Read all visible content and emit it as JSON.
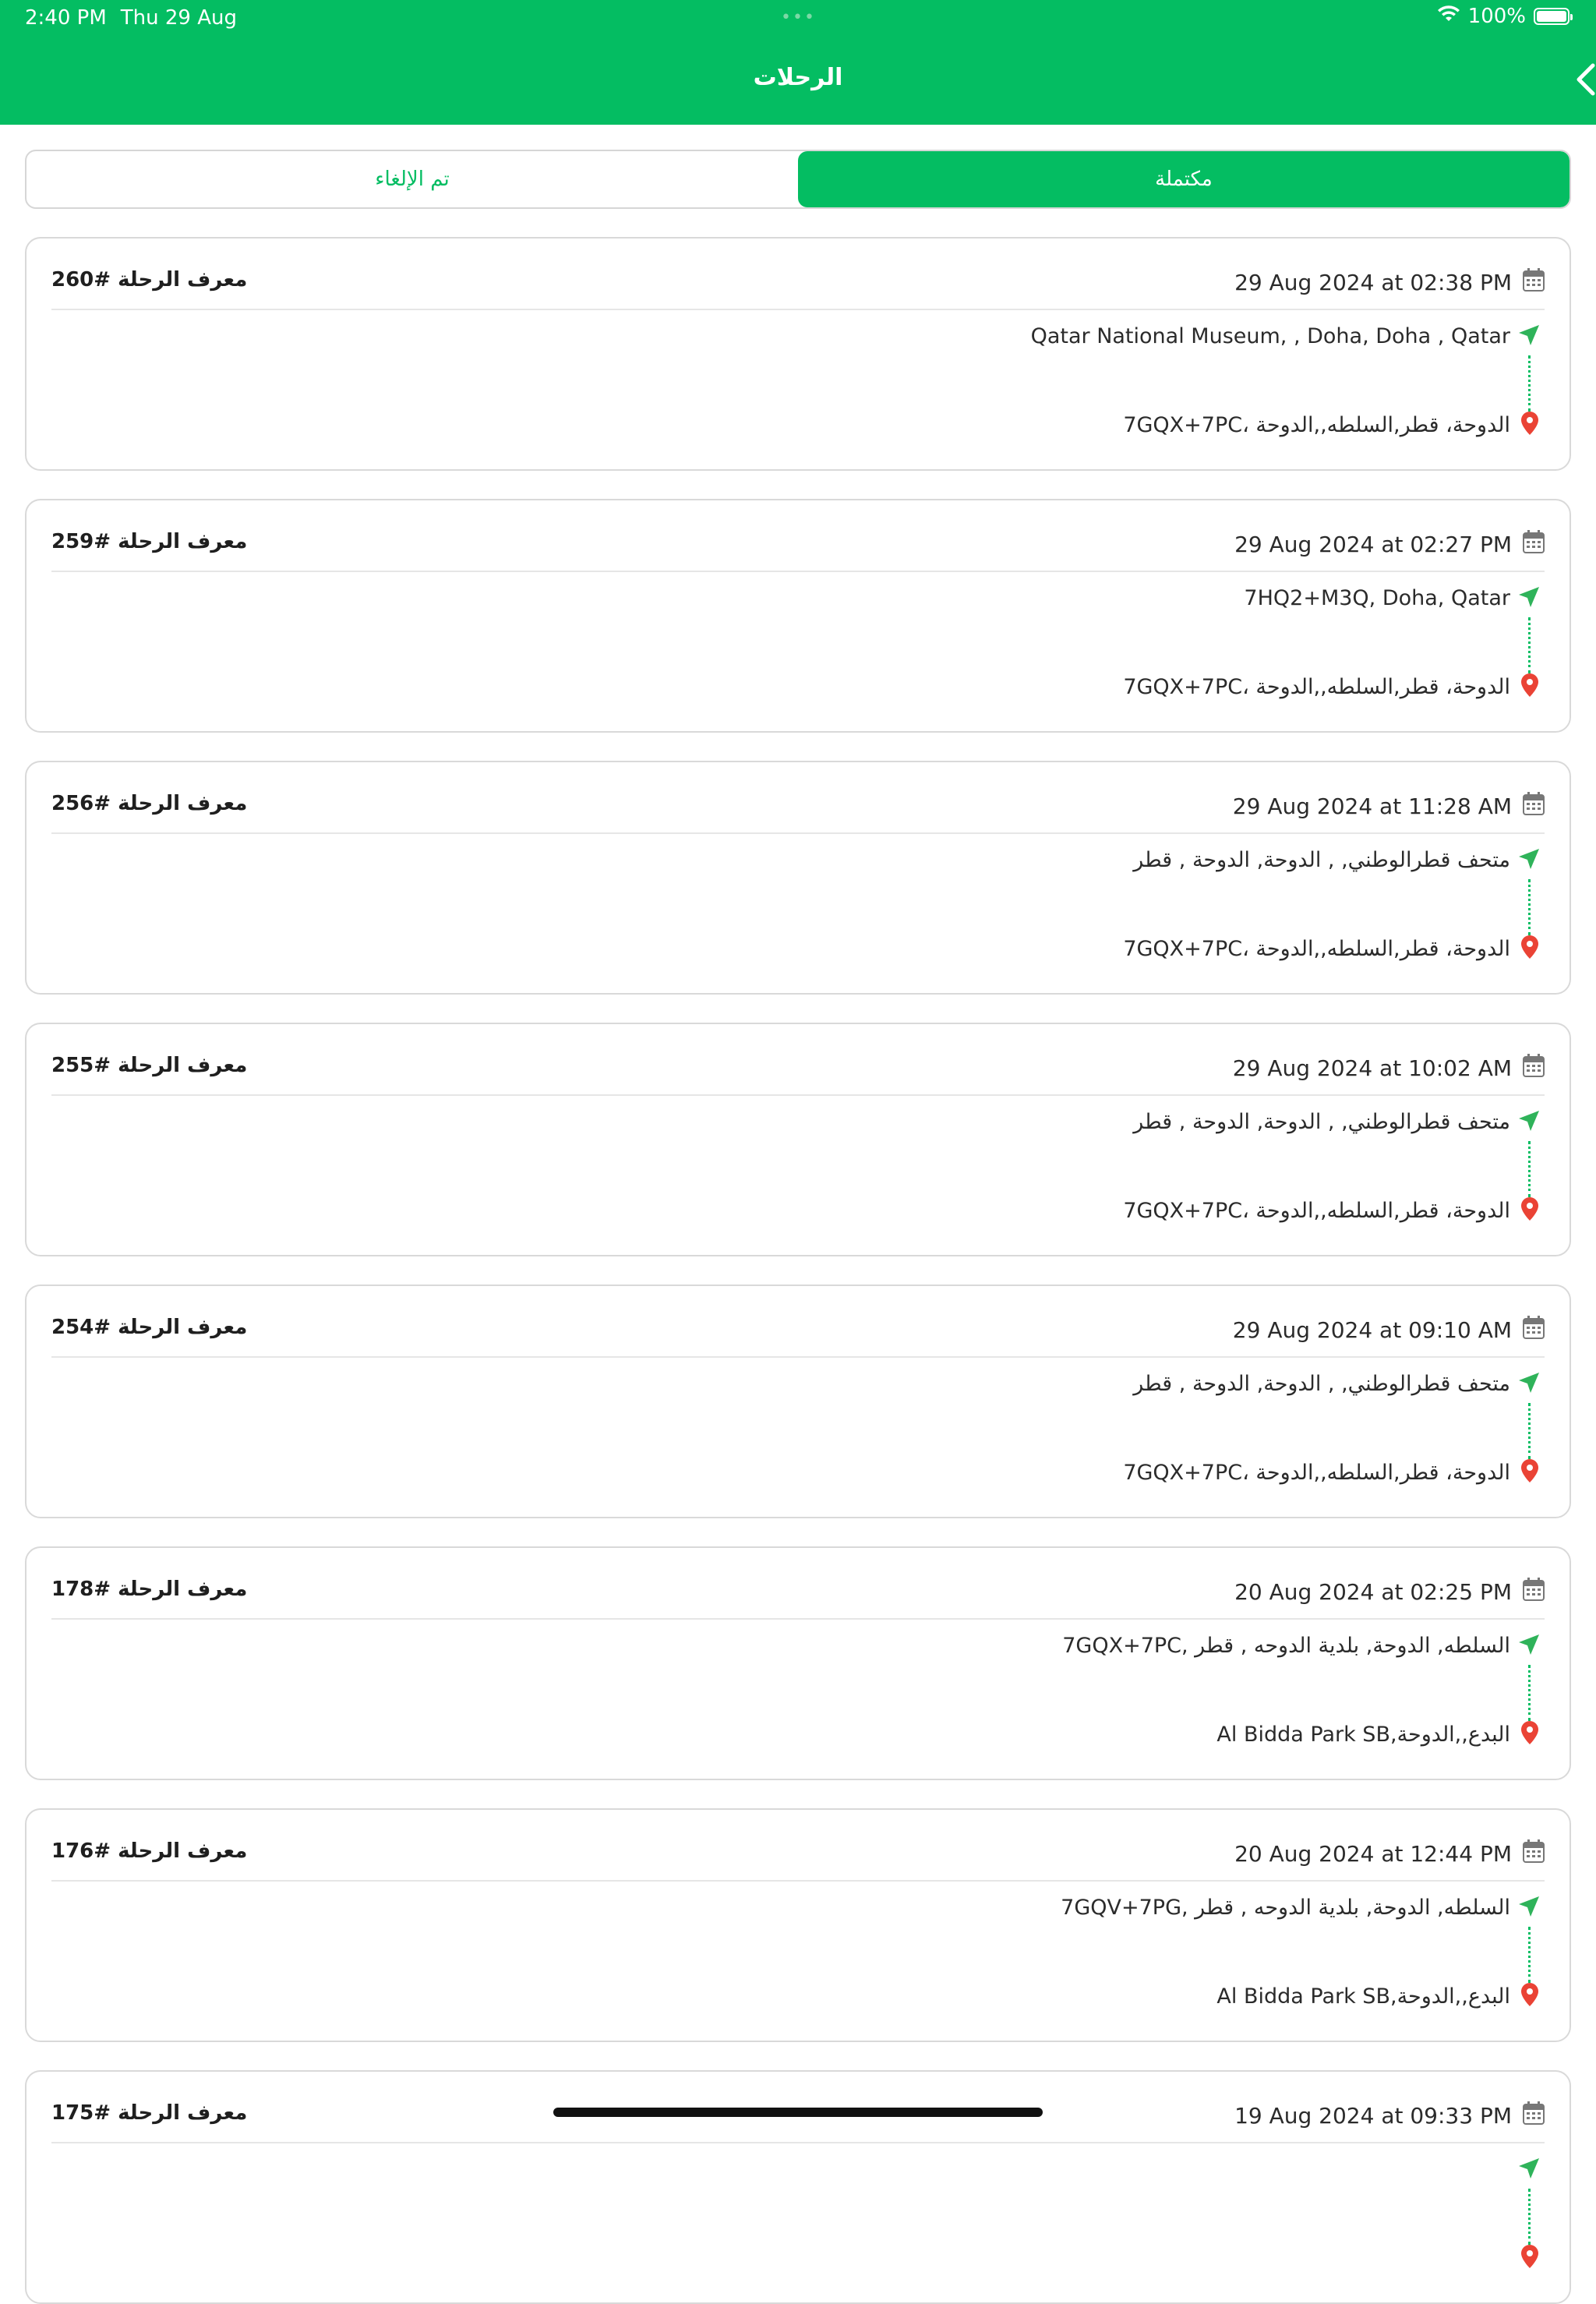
{
  "status_bar": {
    "time": "2:40 PM",
    "date": "Thu 29 Aug",
    "battery": "100%"
  },
  "header": {
    "title": "الرحلات"
  },
  "tabs": {
    "cancelled": "تم الإلغاء",
    "completed": "مكتملة",
    "active": "completed"
  },
  "colors": {
    "primary": "#04bd62",
    "pin": "#ea4335",
    "border": "#d9d9d9"
  },
  "trips": [
    {
      "id": "معرف الرحلة #260",
      "date": "29 Aug 2024 at 02:38 PM",
      "pickup": "Qatar National Museum, , Doha, Doha , Qatar",
      "dropoff": "7GQX+7PC، الدوحة، قطر,السلطه,,الدوحة"
    },
    {
      "id": "معرف الرحلة #259",
      "date": "29 Aug 2024 at 02:27 PM",
      "pickup": "7HQ2+M3Q, Doha, Qatar",
      "dropoff": "7GQX+7PC، الدوحة، قطر,السلطه,,الدوحة"
    },
    {
      "id": "معرف الرحلة #256",
      "date": "29 Aug 2024 at 11:28 AM",
      "pickup": "متحف قطرالوطني, , الدوحة, الدوحة , قطر",
      "dropoff": "7GQX+7PC، الدوحة، قطر,السلطه,,الدوحة"
    },
    {
      "id": "معرف الرحلة #255",
      "date": "29 Aug 2024 at 10:02 AM",
      "pickup": "متحف قطرالوطني, , الدوحة, الدوحة , قطر",
      "dropoff": "7GQX+7PC، الدوحة، قطر,السلطه,,الدوحة"
    },
    {
      "id": "معرف الرحلة #254",
      "date": "29 Aug 2024 at 09:10 AM",
      "pickup": "متحف قطرالوطني, , الدوحة, الدوحة , قطر",
      "dropoff": "7GQX+7PC، الدوحة، قطر,السلطه,,الدوحة"
    },
    {
      "id": "معرف الرحلة #178",
      "date": "20 Aug 2024 at 02:25 PM",
      "pickup": "7GQX+7PC, السلطه, الدوحة, بلدية الدوحه , قطر",
      "dropoff": "Al Bidda Park SB,البدع,,الدوحة"
    },
    {
      "id": "معرف الرحلة #176",
      "date": "20 Aug 2024 at 12:44 PM",
      "pickup": "7GQV+7PG, السلطه, الدوحة, بلدية الدوحه , قطر",
      "dropoff": "Al Bidda Park SB,البدع,,الدوحة"
    },
    {
      "id": "معرف الرحلة #175",
      "date": "19 Aug 2024 at 09:33 PM",
      "pickup": "",
      "dropoff": ""
    }
  ]
}
